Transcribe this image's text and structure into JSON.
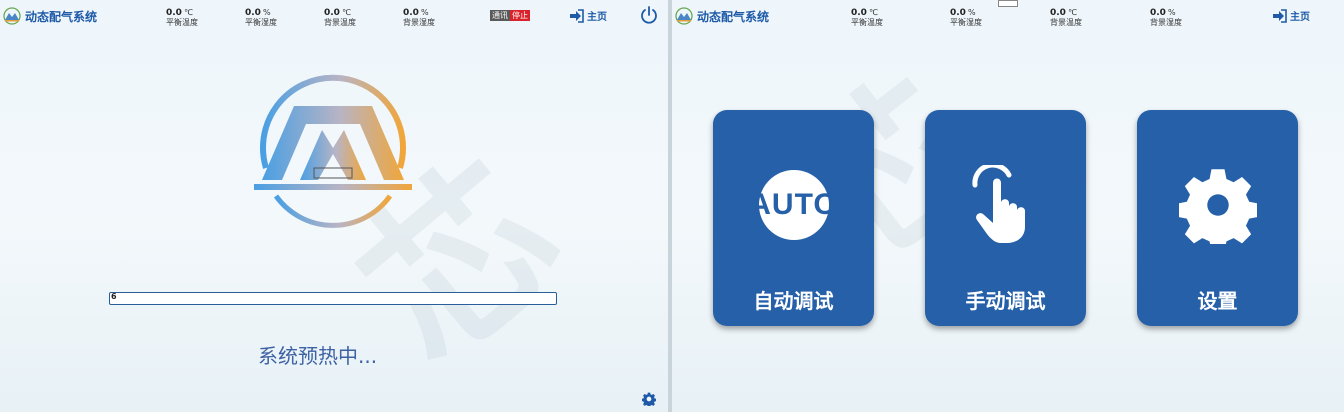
{
  "left": {
    "app_title": "动态配气系统",
    "stats": [
      {
        "value": "0.0",
        "unit": "℃",
        "label": "平衡温度"
      },
      {
        "value": "0.0",
        "unit": "%",
        "label": "平衡湿度"
      },
      {
        "value": "0.0",
        "unit": "℃",
        "label": "背景温度"
      },
      {
        "value": "0.0",
        "unit": "%",
        "label": "背景湿度"
      }
    ],
    "comm_label": "通讯",
    "comm_status": "停止",
    "home_label": "主页",
    "progress": {
      "value": "6",
      "fraction": 0.0
    },
    "status_text": "系统预热中..."
  },
  "right": {
    "app_title": "动态配气系统",
    "stats": [
      {
        "value": "0.0",
        "unit": "℃",
        "label": "平衡温度"
      },
      {
        "value": "0.0",
        "unit": "%",
        "label": "平衡湿度"
      },
      {
        "value": "0.0",
        "unit": "℃",
        "label": "背景温度"
      },
      {
        "value": "0.0",
        "unit": "%",
        "label": "背景湿度"
      }
    ],
    "home_label": "主页",
    "cards": [
      {
        "label": "自动调试",
        "icon": "auto-icon",
        "icon_text": "AUTO"
      },
      {
        "label": "手动调试",
        "icon": "hand-pointer-icon"
      },
      {
        "label": "设置",
        "icon": "gear-icon"
      }
    ]
  },
  "colors": {
    "accent": "#1e5aa8",
    "card_bg": "#2560a9",
    "status_red": "#d9232b",
    "status_text": "#3e62a3"
  }
}
